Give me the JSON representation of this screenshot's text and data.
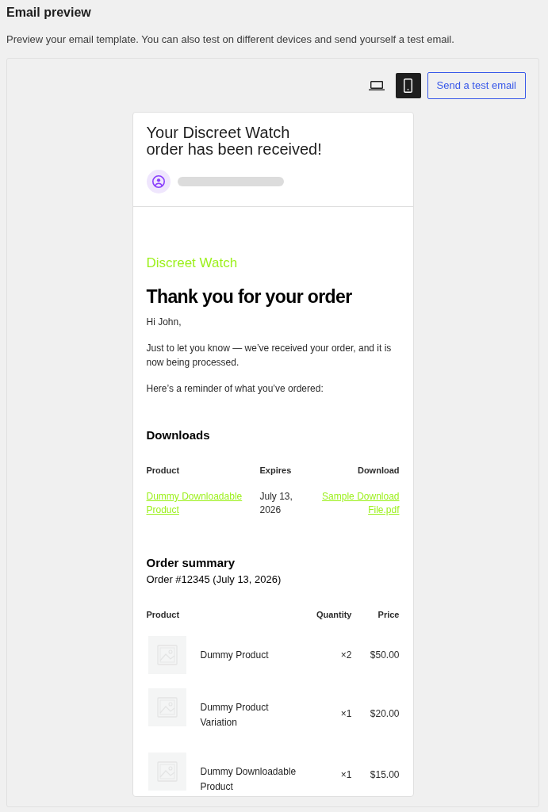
{
  "page": {
    "title": "Email preview",
    "description": "Preview your email template. You can also test on different devices and send yourself a test email."
  },
  "toolbar": {
    "devices": [
      {
        "kind": "desktop",
        "selected": false
      },
      {
        "kind": "mobile",
        "selected": true
      }
    ],
    "send_button": "Send a test email"
  },
  "email_header": {
    "subject": "Your Discreet Watch order has been received!",
    "sender": {
      "redacted": true
    }
  },
  "email_body": {
    "store_name": "Discreet Watch",
    "heading": "Thank you for your order",
    "paragraphs": [
      "Hi John,",
      "Just to let you know — we’ve received your order, and it is now being processed.",
      "Here’s a reminder of what you’ve ordered:"
    ],
    "downloads": {
      "title": "Downloads",
      "columns": [
        "Product",
        "Expires",
        "Download"
      ],
      "rows": [
        {
          "product": "Dummy Downloadable Product",
          "expires": "July 13, 2026",
          "file": "Sample Download File.pdf"
        }
      ]
    },
    "order_summary": {
      "title": "Order summary",
      "order_line": "Order #12345 (July 13, 2026)",
      "columns": [
        "Product",
        "Quantity",
        "Price"
      ],
      "items": [
        {
          "name": "Dummy Product",
          "quantity": "×2",
          "price": "$50.00"
        },
        {
          "name": "Dummy Product Variation",
          "quantity": "×1",
          "price": "$20.00"
        },
        {
          "name": "Dummy Downloadable Product",
          "quantity": "×1",
          "price": "$15.00"
        }
      ]
    }
  }
}
